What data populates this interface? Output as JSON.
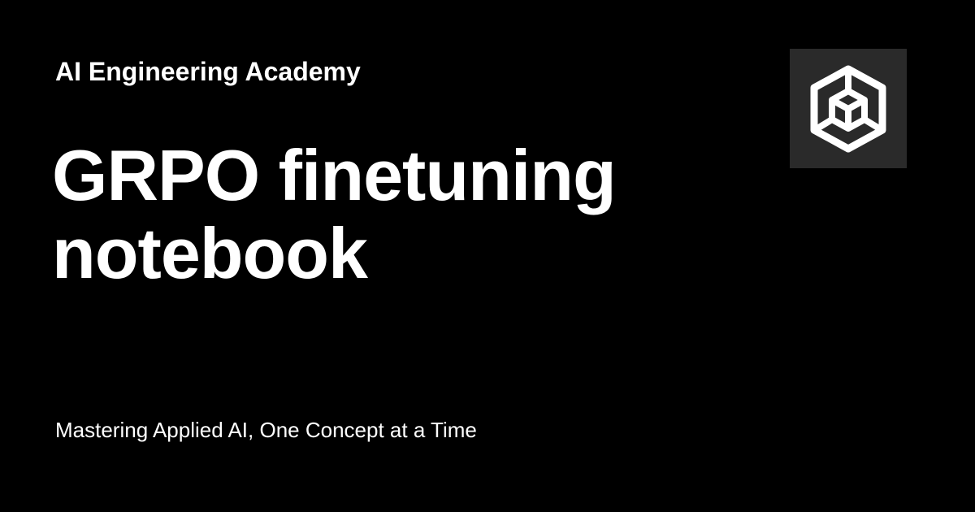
{
  "card": {
    "site_name": "AI Engineering Academy",
    "title": "GRPO finetuning notebook",
    "tagline": "Mastering Applied AI, One Concept at a Time",
    "logo_icon": "hexagon-cube-icon",
    "colors": {
      "background": "#000000",
      "text": "#ffffff",
      "logo_background": "#2a2a2a",
      "logo_stroke": "#ffffff"
    }
  }
}
